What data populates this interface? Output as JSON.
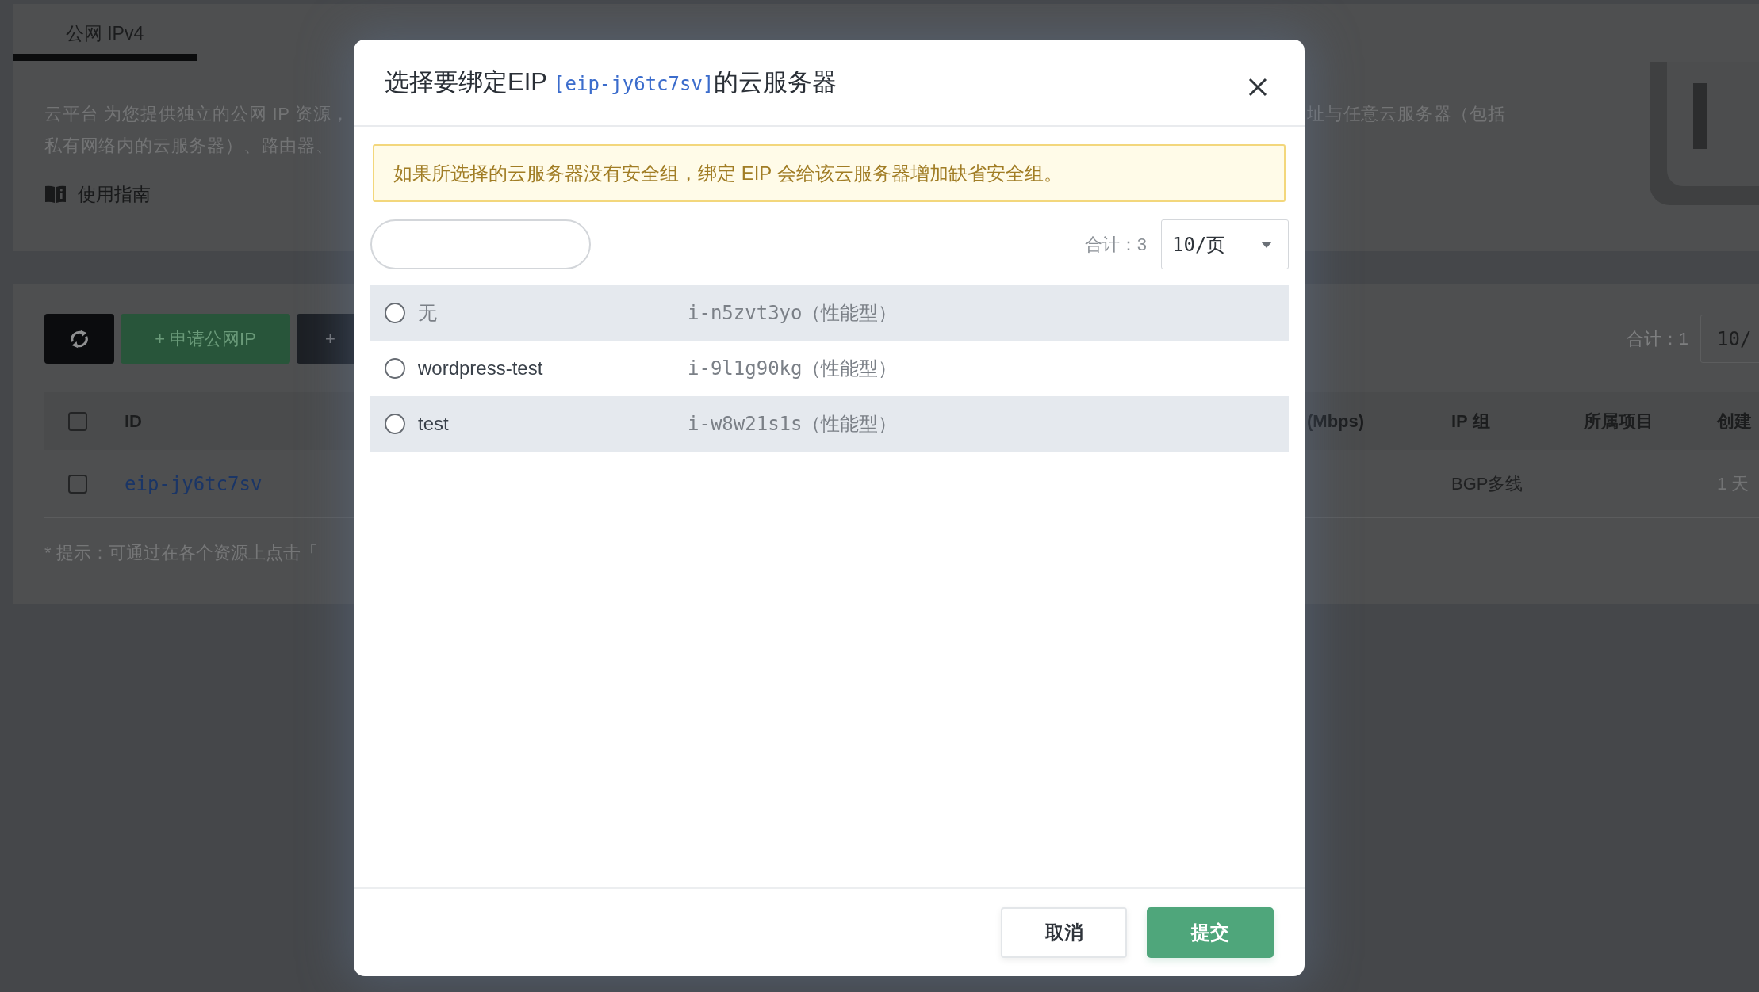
{
  "page": {
    "tabs": [
      {
        "label": "公网 IPv4",
        "selected": true
      }
    ],
    "intro": {
      "lines": [
        {
          "left": "云平台 为您提供独立的公网 IP 资源，",
          "right": "址与任意云服务器（包括"
        },
        {
          "left": "私有网络内的云服务器）、路由器、"
        }
      ],
      "guide_link": "使用指南",
      "illustration_text": "I"
    },
    "toolbar": {
      "buttons": [
        {
          "kind": "refresh"
        },
        {
          "kind": "primary",
          "label": "+ 申请公网IP"
        },
        {
          "kind": "dark",
          "label": "+"
        }
      ],
      "total": "合计：1",
      "page_size": "10/"
    },
    "table": {
      "select_all_checked": false,
      "columns": [
        "ID",
        "(Mbps)",
        "IP 组",
        "所属项目",
        "创建"
      ],
      "rows": [
        {
          "checked": false,
          "id": "eip-jy6tc7sv",
          "ip_group": "BGP多线",
          "created": "1 天"
        }
      ]
    },
    "hint": "* 提示：可通过在各个资源上点击「"
  },
  "dialog": {
    "title": {
      "prefix": "选择要绑定EIP ",
      "resource_id": "[eip-jy6tc7sv]",
      "suffix": "的云服务器"
    },
    "warning": "如果所选择的云服务器没有安全组，绑定 EIP 会给该云服务器增加缺省安全组。",
    "total": "合计：3",
    "page_size": "10/页",
    "options": [
      {
        "kind": "none",
        "name": "无",
        "instance": "i-n5zvt3yo（性能型）",
        "selected": false
      },
      {
        "kind": "server",
        "name": "wordpress-test",
        "instance": "i-9l1g90kg（性能型）",
        "selected": false
      },
      {
        "kind": "server",
        "name": "test",
        "instance": "i-w8w21s1s（性能型）",
        "selected": false
      }
    ],
    "buttons": [
      {
        "kind": "cancel",
        "label": "取消"
      },
      {
        "kind": "submit",
        "label": "提交"
      }
    ]
  }
}
